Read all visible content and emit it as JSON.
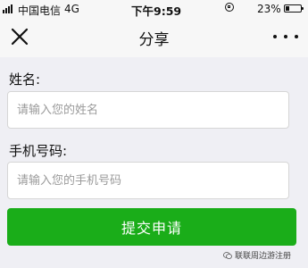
{
  "status_bar": {
    "carrier": "中国电信",
    "network": "4G",
    "time": "下午9:59",
    "battery_text": "23%",
    "battery_level": 0.23
  },
  "nav": {
    "title": "分享"
  },
  "form": {
    "name_label": "姓名:",
    "name_placeholder": "请输入您的姓名",
    "phone_label": "手机号码:",
    "phone_placeholder": "请输入您的手机号码",
    "submit_label": "提交申请"
  },
  "watermark": {
    "text": "联联周边游注册"
  },
  "colors": {
    "accent": "#1aad19",
    "background": "#efeff4",
    "navbar": "#f7f7f7"
  }
}
